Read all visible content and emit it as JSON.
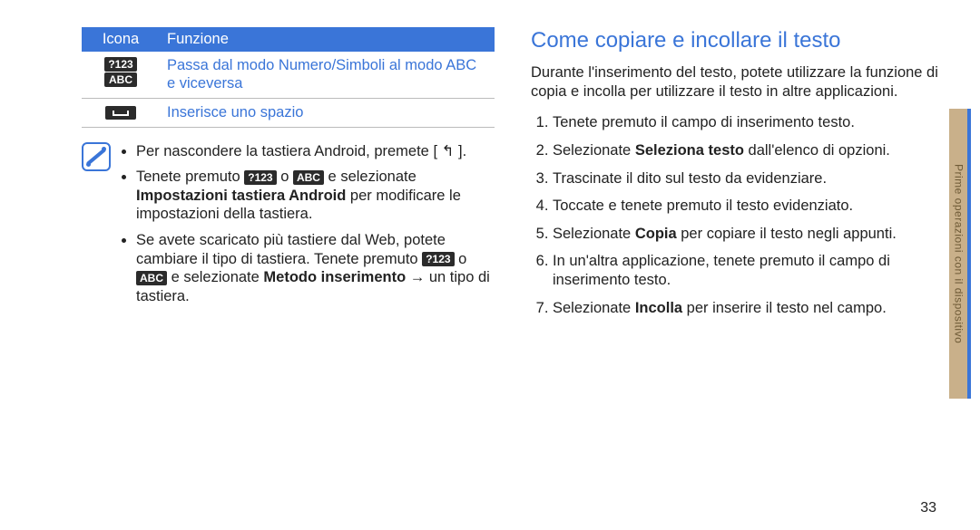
{
  "table": {
    "headers": [
      "Icona",
      "Funzione"
    ],
    "rows": [
      {
        "icon_ids": [
          "?123",
          "ABC"
        ],
        "func": "Passa dal modo Numero/Simboli al modo ABC e viceversa"
      },
      {
        "icon_ids": [
          "space"
        ],
        "func": "Inserisce uno spazio"
      }
    ]
  },
  "note": {
    "items": [
      {
        "parts": [
          {
            "t": "Per nascondere la tastiera Android, premete [ "
          },
          {
            "glyph": "↰"
          },
          {
            "t": " ]."
          }
        ]
      },
      {
        "parts": [
          {
            "t": "Tenete premuto "
          },
          {
            "key": "?123"
          },
          {
            "t": " o "
          },
          {
            "key": "ABC"
          },
          {
            "t": " e selezionate "
          },
          {
            "b": "Impostazioni tastiera Android"
          },
          {
            "t": " per modificare le impostazioni della tastiera."
          }
        ]
      },
      {
        "parts": [
          {
            "t": "Se avete scaricato più tastiere dal Web, potete cambiare il tipo di tastiera. Tenete premuto "
          },
          {
            "key": "?123"
          },
          {
            "t": " o "
          },
          {
            "key": "ABC"
          },
          {
            "t": " e selezionate "
          },
          {
            "b": "Metodo inserimento"
          },
          {
            "t": " → un tipo di tastiera."
          }
        ]
      }
    ]
  },
  "right": {
    "heading": "Come copiare e incollare il testo",
    "intro": "Durante l'inserimento del testo, potete utilizzare la funzione di copia e incolla per utilizzare il testo in altre applicazioni.",
    "steps": [
      [
        {
          "t": "Tenete premuto il campo di inserimento testo."
        }
      ],
      [
        {
          "t": "Selezionate "
        },
        {
          "b": "Seleziona testo"
        },
        {
          "t": " dall'elenco di opzioni."
        }
      ],
      [
        {
          "t": "Trascinate il dito sul testo da evidenziare."
        }
      ],
      [
        {
          "t": "Toccate e tenete premuto il testo evidenziato."
        }
      ],
      [
        {
          "t": "Selezionate "
        },
        {
          "b": "Copia"
        },
        {
          "t": " per copiare il testo negli appunti."
        }
      ],
      [
        {
          "t": "In un'altra applicazione, tenete premuto il campo di inserimento testo."
        }
      ],
      [
        {
          "t": "Selezionate "
        },
        {
          "b": "Incolla"
        },
        {
          "t": " per inserire il testo nel campo."
        }
      ]
    ]
  },
  "side_tab": "Prime operazioni con il dispositivo",
  "page_number": "33"
}
